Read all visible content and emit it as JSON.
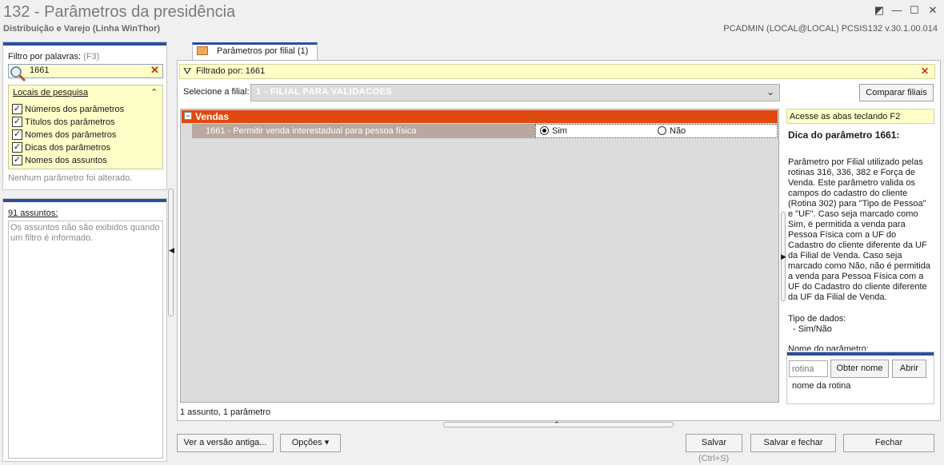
{
  "window": {
    "title": "132 - Parâmetros da presidência",
    "subtitle": "Distribuição e Varejo (Linha WinThor)",
    "user_info": "PCADMIN (LOCAL@LOCAL)   PCSIS132  v.30.1.00.014",
    "controls": [
      "restore-icon",
      "minimize-icon",
      "maximize-icon",
      "close-icon"
    ]
  },
  "filter": {
    "label": "Filtro por palavras:",
    "shortcut": "(F3)",
    "search_value": "1661",
    "locations_title": "Locais de pesquisa",
    "locations": [
      {
        "label": "Números dos parâmetros",
        "checked": true
      },
      {
        "label": "Títulos dos parâmetros",
        "checked": true
      },
      {
        "label": "Nomes dos parâmetros",
        "checked": true
      },
      {
        "label": "Dicas dos parâmetros",
        "checked": true
      },
      {
        "label": "Nomes dos assuntos",
        "checked": true
      }
    ],
    "no_change_text": "Nenhum parâmetro foi alterado."
  },
  "subjects": {
    "count_label": "91 assuntos:",
    "message": "Os assuntos não são exibidos quando um filtro é informado."
  },
  "tab": {
    "label": "Parâmetros por filial  (1)"
  },
  "filterbar": {
    "text": "Filtrado por: 1661"
  },
  "filial": {
    "label": "Selecione a filial:",
    "value": "1 - FILIAL PARA VALIDACOES",
    "compare_button": "Comparar filiais"
  },
  "grid": {
    "group": "Vendas",
    "param": "1661 - Permitir venda interestadual para pessoa física",
    "options": [
      {
        "label": "Sim",
        "selected": true
      },
      {
        "label": "Não",
        "selected": false
      }
    ]
  },
  "status": "1 assunto, 1 parâmetro",
  "tip": {
    "hint": "Acesse as abas teclando F2",
    "title": "Dica do parâmetro 1661:",
    "body": "Parâmetro por Filial utilizado pelas rotinas 316, 336, 382 e Força de Venda. Este parâmetro valida os campos do cadastro do cliente (Rotina 302) para \"Tipo de Pessoa\" e \"UF\". Caso seja marcado como Sim, é permitida a venda para Pessoa Física com a UF do Cadastro do cliente diferente da UF da Filial de Venda. Caso seja marcado como Não, não é permitida a venda para Pessoa Física com a UF do Cadastro do cliente diferente da UF da Filial de Venda.",
    "type_label": "Tipo de dados:",
    "type_value": "- Sim/Não",
    "name_label": "Nome do parâmetro:"
  },
  "routine": {
    "placeholder": "rotina",
    "get_name_button": "Obter nome",
    "open_button": "Abrir",
    "name_text": "nome da rotina"
  },
  "buttons": {
    "old_version": "Ver a versão antiga...",
    "options": "Opções ▾",
    "save": "Salvar",
    "save_shortcut": "(Ctrl+S)",
    "save_close": "Salvar e fechar",
    "close": "Fechar"
  },
  "colors": {
    "accent_blue": "#2b4fa0",
    "group_orange": "#e04a10",
    "highlight_yellow": "#fefec8"
  }
}
